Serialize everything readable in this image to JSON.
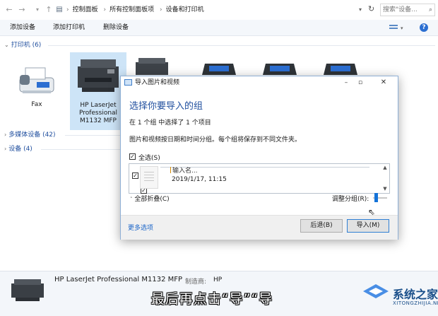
{
  "explorer": {
    "breadcrumb": [
      "控制面板",
      "所有控制面板项",
      "设备和打印机"
    ],
    "search_placeholder": "搜索\"设备...",
    "commands": [
      "添加设备",
      "添加打印机",
      "删除设备"
    ],
    "groups": {
      "printers": "打印机 (6)",
      "multimedia": "多媒体设备 (42)",
      "devices": "设备 (4)"
    },
    "printers": [
      {
        "label": "Fax"
      },
      {
        "label_lines": [
          "HP LaserJet",
          "Professional",
          "M1132 MFP"
        ]
      }
    ]
  },
  "dialog": {
    "title": "导入图片和视频",
    "heading": "选择你要导入的组",
    "selection_status": "在 1 个组 中选择了 1 个项目",
    "description": "图片和视频按日期和时间分组。每个组将保存到不同文件夹。",
    "select_all": "全选(S)",
    "group": {
      "name_placeholder": "输入名...",
      "date": "2019/1/17, 11:15"
    },
    "collapse_all": "全部折叠(C)",
    "adjust_grouping": "调整分组(R):",
    "more_options": "更多选项",
    "buttons": {
      "back": "后退(B)",
      "import": "导入(M)"
    }
  },
  "details": {
    "name": "HP LaserJet Professional M1132 MFP",
    "manufacturer_label": "制造商:",
    "manufacturer_value": "HP"
  },
  "subtitle": "最后再点击“导”“导",
  "watermark": {
    "text": "系统之家",
    "url": "XITONGZHIJIA.NET"
  },
  "colors": {
    "accent": "#1f4e9e",
    "selection": "#cde4f7",
    "link": "#1a64c8"
  }
}
